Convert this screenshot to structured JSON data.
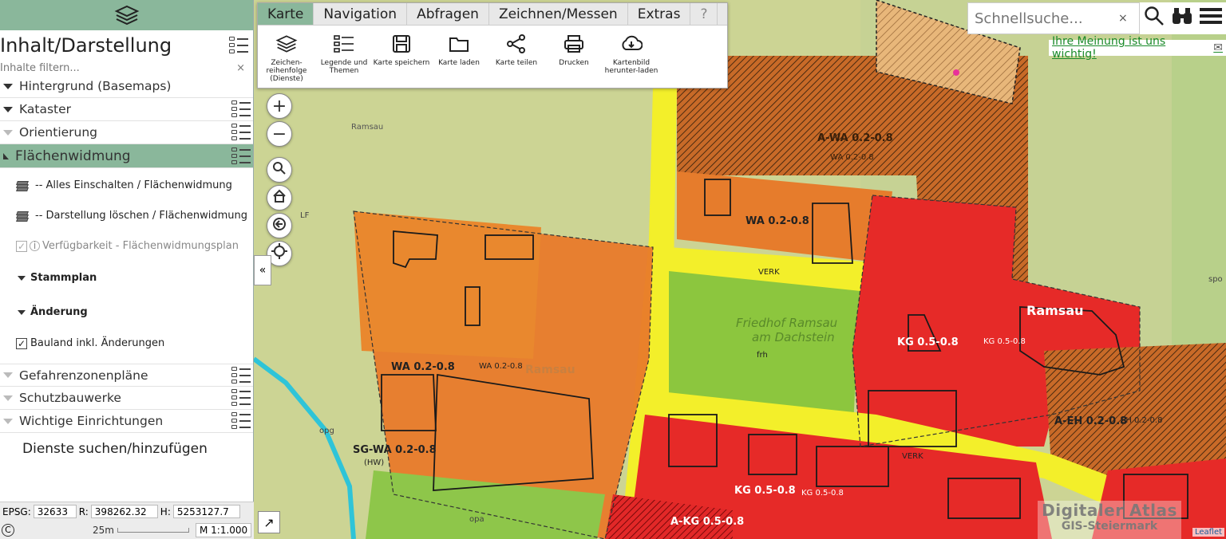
{
  "sidebar": {
    "title": "Inhalt/Darstellung",
    "filter_placeholder": "Inhalte filtern...",
    "filter_clear": "×",
    "categories": [
      {
        "label": "Hintergrund (Basemaps)"
      },
      {
        "label": "Kataster"
      },
      {
        "label": "Orientierung"
      },
      {
        "label": "Flächenwidmung"
      }
    ],
    "flaechenwidmung_items": {
      "all_on": "-- Alles Einschalten / Flächenwidmung",
      "clear": "-- Darstellung löschen / Flächenwidmung",
      "availability": "Verfügbarkeit - Flächenwidmungsplan",
      "stammplan": "Stammplan",
      "aenderung": "Änderung",
      "bauland": "Bauland inkl. Änderungen"
    },
    "categories_bottom": [
      {
        "label": "Gefahrenzonenpläne"
      },
      {
        "label": "Schutzbauwerke"
      },
      {
        "label": "Wichtige Einrichtungen"
      }
    ],
    "services_label": "Dienste suchen/hinzufügen"
  },
  "coords": {
    "epsg_label": "EPSG:",
    "epsg": "32633",
    "r_label": "R:",
    "r": "398262.32",
    "h_label": "H:",
    "h": "5253127.7"
  },
  "scale": {
    "bar_label": "25m",
    "ratio": "M 1:1.000",
    "copyright": "C"
  },
  "toolbar": {
    "tabs": [
      "Karte",
      "Navigation",
      "Abfragen",
      "Zeichnen/Messen",
      "Extras",
      "?"
    ],
    "tools": [
      {
        "label": "Zeichen-reihenfolge (Dienste)",
        "icon": "layers-icon"
      },
      {
        "label": "Legende und Themen",
        "icon": "legend-icon"
      },
      {
        "label": "Karte speichern",
        "icon": "save-icon"
      },
      {
        "label": "Karte laden",
        "icon": "folder-icon"
      },
      {
        "label": "Karte teilen",
        "icon": "share-icon"
      },
      {
        "label": "Drucken",
        "icon": "print-icon"
      },
      {
        "label": "Kartenbild herunter-laden",
        "icon": "download-icon"
      }
    ]
  },
  "search": {
    "placeholder": "Schnellsuche...",
    "clear": "×"
  },
  "feedback": {
    "label": "Ihre Meinung ist uns wichtig!"
  },
  "map_labels": {
    "awa_main": "A-WA 0.2-0.8",
    "awa_sub": "WA 0.2-0.8",
    "wa_top": "WA 0.2-0.8",
    "wa_left": "WA 0.2-0.8",
    "wa_left_small": "WA 0.2-0.8",
    "sgwa": "SG-WA 0.2-0.8",
    "sgwa_hw": "(HW)",
    "kg_right": "KG 0.5-0.8",
    "kg_right_small": "KG 0.5-0.8",
    "kg_bottom": "KG 0.5-0.8",
    "kg_bottom_small": "KG 0.5-0.8",
    "akg": "A-KG 0.5-0.8",
    "aeh": "A-EH 0.2-0.8",
    "aeh_small": "EH 0.2-0.8",
    "verk1": "VERK",
    "verk2": "VERK",
    "friedhof1": "Friedhof Ramsau",
    "friedhof2": "am Dachstein",
    "frh": "frh",
    "ramsau1": "Ramsau",
    "ramsau2": "Ramsau",
    "ramsau3": "Ramsau",
    "lf": "LF",
    "opg": "opg",
    "opa": "opa",
    "spo": "spo"
  },
  "brand": {
    "line1": "Digitaler Atlas",
    "line2": "GIS-Steiermark",
    "leaflet": "Leaflet"
  }
}
